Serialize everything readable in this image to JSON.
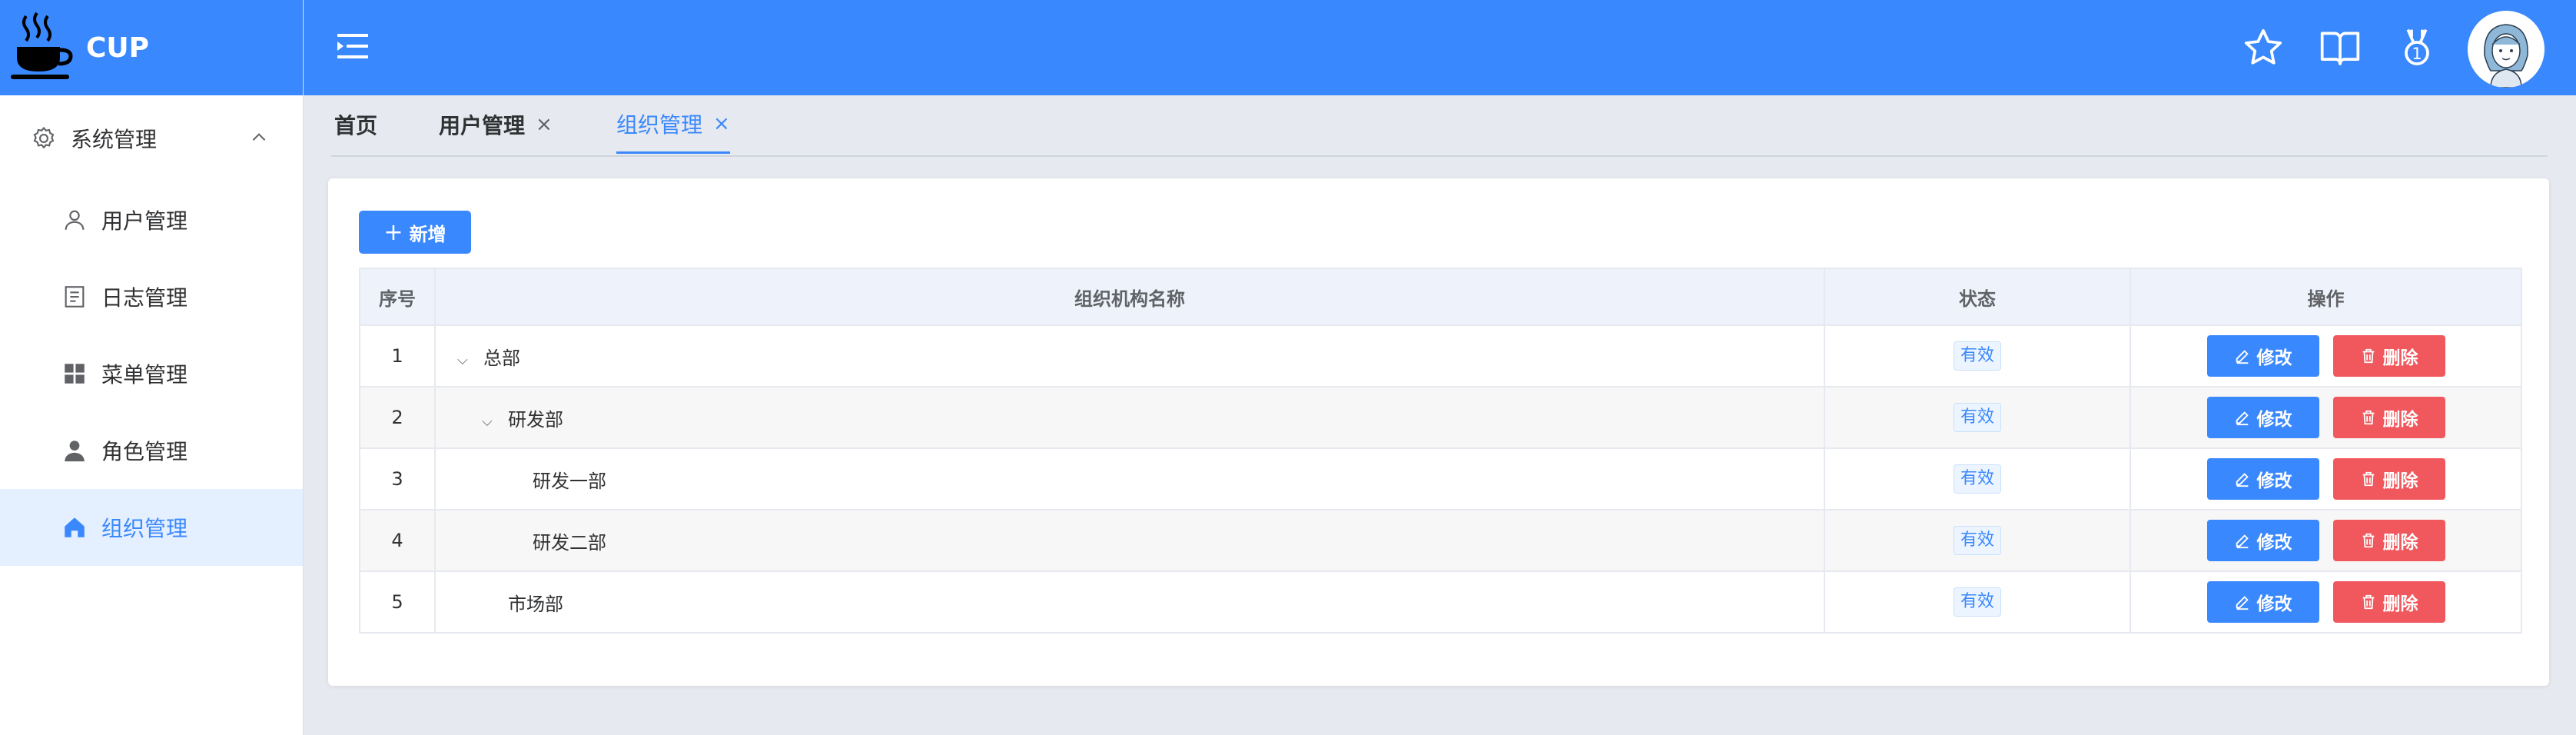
{
  "app": {
    "name": "CUP"
  },
  "sidebar": {
    "group_label": "系统管理",
    "items": [
      {
        "label": "用户管理",
        "icon": "user-icon"
      },
      {
        "label": "日志管理",
        "icon": "document-icon"
      },
      {
        "label": "菜单管理",
        "icon": "grid-icon"
      },
      {
        "label": "角色管理",
        "icon": "person-icon"
      },
      {
        "label": "组织管理",
        "icon": "home-icon",
        "active": true
      }
    ]
  },
  "header": {
    "icons": [
      "menu-fold-icon",
      "star-icon",
      "book-icon",
      "medal-icon",
      "avatar"
    ]
  },
  "tabs": [
    {
      "label": "首页"
    },
    {
      "label": "用户管理",
      "close": "×"
    },
    {
      "label": "组织管理",
      "close": "×",
      "active": true
    }
  ],
  "toolbar": {
    "add_label": "新增",
    "add_plus": "+"
  },
  "table": {
    "headers": {
      "index": "序号",
      "name": "组织机构名称",
      "status": "状态",
      "ops": "操作"
    },
    "rows": [
      {
        "index": "1",
        "name": "总部",
        "status": "有效",
        "expanded": true
      },
      {
        "index": "2",
        "name": "研发部",
        "status": "有效",
        "expanded": true
      },
      {
        "index": "3",
        "name": "研发一部",
        "status": "有效"
      },
      {
        "index": "4",
        "name": "研发二部",
        "status": "有效"
      },
      {
        "index": "5",
        "name": "市场部",
        "status": "有效"
      }
    ],
    "edit_label": "修改",
    "delete_label": "删除"
  },
  "colors": {
    "primary": "#3a88fd",
    "danger": "#f1585d",
    "active_bg": "#e4efff"
  }
}
